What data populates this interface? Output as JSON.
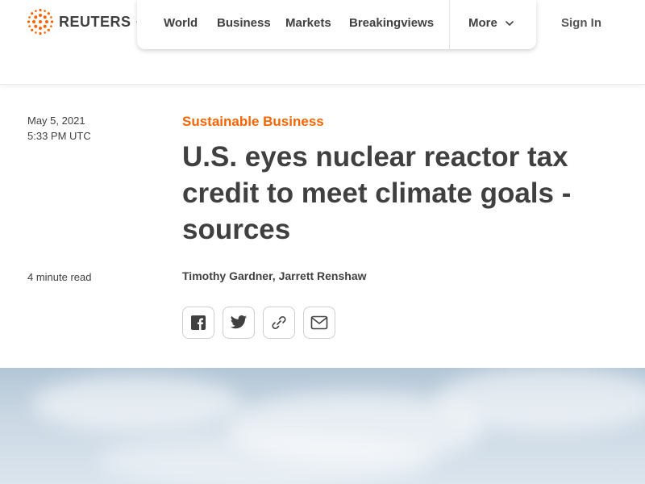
{
  "header": {
    "logo_text": "REUTERS",
    "nav": [
      {
        "label": "World"
      },
      {
        "label": "Business"
      },
      {
        "label": "Markets"
      },
      {
        "label": "Breakingviews"
      },
      {
        "label": "More"
      }
    ],
    "sign_in": "Sign In"
  },
  "article": {
    "date": "May 5, 2021",
    "time": "5:33 PM UTC",
    "read_time": "4 minute read",
    "category": "Sustainable Business",
    "headline": "U.S. eyes nuclear reactor tax credit to meet climate goals - sources",
    "authors": [
      "Timothy Gardner",
      "Jarrett Renshaw"
    ],
    "author_separator": ", "
  },
  "share": {
    "icons": [
      "facebook-icon",
      "twitter-icon",
      "link-icon",
      "email-icon"
    ]
  },
  "colors": {
    "accent": "#fa6400",
    "text": "#404040"
  }
}
